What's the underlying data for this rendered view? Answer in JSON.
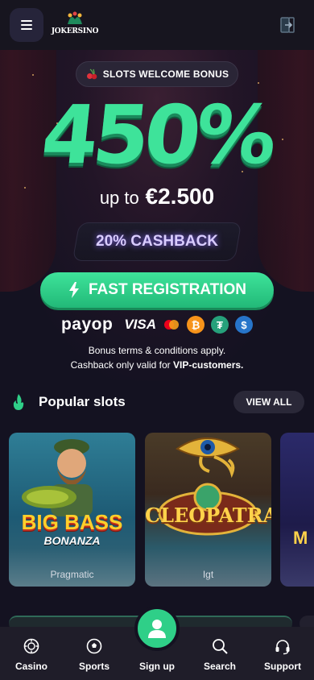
{
  "header": {
    "logo_text": "JOKERSINO",
    "menu_icon": "hamburger-menu-icon",
    "login_icon": "login-door-icon"
  },
  "hero": {
    "bonus_badge": "SLOTS WELCOME BONUS",
    "percent": "450%",
    "up_to_prefix": "up to",
    "up_to_amount": "€2.500",
    "cashback": "20% CASHBACK",
    "register_button": "FAST REGISTRATION",
    "payments": {
      "payop": "payop",
      "visa": "VISA",
      "icons": [
        "mastercard-icon",
        "bitcoin-icon",
        "tether-icon",
        "usdc-icon"
      ]
    },
    "terms_line1": "Bonus terms & conditions apply.",
    "terms_line2_prefix": "Cashback only valid for",
    "terms_line2_bold": "VIP-customers."
  },
  "popular_slots": {
    "title": "Popular slots",
    "view_all": "VIEW ALL",
    "games": [
      {
        "title": "BIG BASS",
        "subtitle": "BONANZA",
        "provider": "Pragmatic"
      },
      {
        "title": "CLEOPATRA",
        "provider": "Igt"
      },
      {
        "title": "M",
        "provider": ""
      }
    ]
  },
  "bottom_nav": {
    "items": [
      {
        "label": "Casino",
        "icon": "casino-chip-icon"
      },
      {
        "label": "Sports",
        "icon": "soccer-ball-icon"
      },
      {
        "label": "Sign up",
        "icon": "user-icon"
      },
      {
        "label": "Search",
        "icon": "search-icon"
      },
      {
        "label": "Support",
        "icon": "headset-icon"
      }
    ]
  },
  "colors": {
    "background": "#141221",
    "accent_green": "#3ee39a",
    "nav_bg": "#1f1d29"
  }
}
